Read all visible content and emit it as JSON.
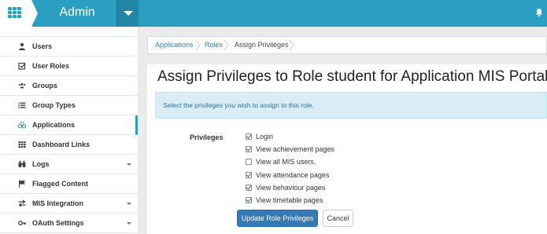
{
  "header": {
    "app_title": "Admin",
    "brand_color": "#2a9fc1",
    "icons": [
      "grid-icon",
      "chevron-down-icon",
      "bell-icon"
    ]
  },
  "sidebar": {
    "items": [
      {
        "label": "Users",
        "icon": "user-icon",
        "submenu": false,
        "active": false
      },
      {
        "label": "User Roles",
        "icon": "checkbox-icon",
        "submenu": false,
        "active": false
      },
      {
        "label": "Groups",
        "icon": "users-icon",
        "submenu": false,
        "active": false
      },
      {
        "label": "Group Types",
        "icon": "list-icon",
        "submenu": false,
        "active": false
      },
      {
        "label": "Applications",
        "icon": "cubes-icon",
        "submenu": false,
        "active": true
      },
      {
        "label": "Dashboard Links",
        "icon": "grid-icon",
        "submenu": false,
        "active": false
      },
      {
        "label": "Logs",
        "icon": "binoculars-icon",
        "submenu": true,
        "active": false
      },
      {
        "label": "Flagged Content",
        "icon": "flag-icon",
        "submenu": false,
        "active": false
      },
      {
        "label": "MIS Integration",
        "icon": "exchange-icon",
        "submenu": true,
        "active": false
      },
      {
        "label": "OAuth Settings",
        "icon": "key-icon",
        "submenu": true,
        "active": false
      }
    ]
  },
  "breadcrumb": [
    "Applications",
    "Roles",
    "Assign Privileges"
  ],
  "page": {
    "title": "Assign Privileges to Role student for Application MIS Portal",
    "info": "Select the privileges you wish to assign to this role.",
    "privileges_label": "Privileges",
    "privileges": [
      {
        "label": "Login",
        "checked": true
      },
      {
        "label": "View achievement pages",
        "checked": true
      },
      {
        "label": "View all MIS users.",
        "checked": false
      },
      {
        "label": "View attendance pages",
        "checked": true
      },
      {
        "label": "View behaviour pages",
        "checked": true
      },
      {
        "label": "View timetable pages",
        "checked": true
      }
    ],
    "submit_label": "Update Role Privileges",
    "cancel_label": "Cancel"
  }
}
